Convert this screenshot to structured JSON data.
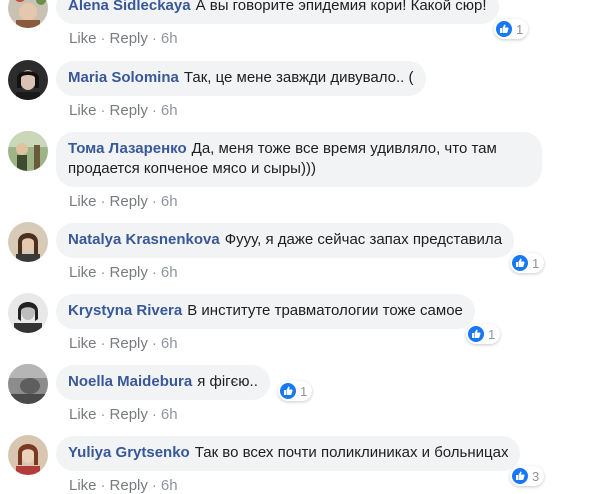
{
  "colors": {
    "author": "#385898",
    "bubble": "#f2f3f5",
    "meta": "#90949c",
    "like_blue": "#1877f2"
  },
  "comments": [
    {
      "author": "Alena Sidleckaya",
      "text": "А вы говорите эпидемия кори! Какой сюр!",
      "like_label": "Like",
      "reply_label": "Reply",
      "time": "6h",
      "reaction_count": "1",
      "avatar": "avatar-flowers"
    },
    {
      "author": "Maria Solomina",
      "text": "Так, це мене завжди дивувало.. (",
      "like_label": "Like",
      "reply_label": "Reply",
      "time": "6h",
      "avatar": "avatar-woman-dark"
    },
    {
      "author": "Тома Лазаренко",
      "text": "Да, меня тоже все время удивляло, что там продается копченое мясо и сыры)))",
      "like_label": "Like",
      "reply_label": "Reply",
      "time": "6h",
      "avatar": "avatar-outdoor"
    },
    {
      "author": "Natalya Krasnenkova",
      "text": "Фууу, я даже сейчас запах представила",
      "like_label": "Like",
      "reply_label": "Reply",
      "time": "6h",
      "reaction_count": "1",
      "avatar": "avatar-woman-brunette"
    },
    {
      "author": "Krystyna Rivera",
      "text": "В институте травматологии тоже самое",
      "like_label": "Like",
      "reply_label": "Reply",
      "time": "6h",
      "reaction_count": "1",
      "avatar": "avatar-bw-portrait"
    },
    {
      "author": "Noella Maidebura",
      "text": "я фігєю..",
      "like_label": "Like",
      "reply_label": "Reply",
      "time": "6h",
      "reaction_count": "1",
      "avatar": "avatar-grey-photo"
    },
    {
      "author": "Yuliya Grytsenko",
      "text": "Так во всех почти поликлиниках и больницах",
      "like_label": "Like",
      "reply_label": "Reply",
      "time": "6h",
      "reaction_count": "3",
      "avatar": "avatar-woman-red"
    }
  ]
}
